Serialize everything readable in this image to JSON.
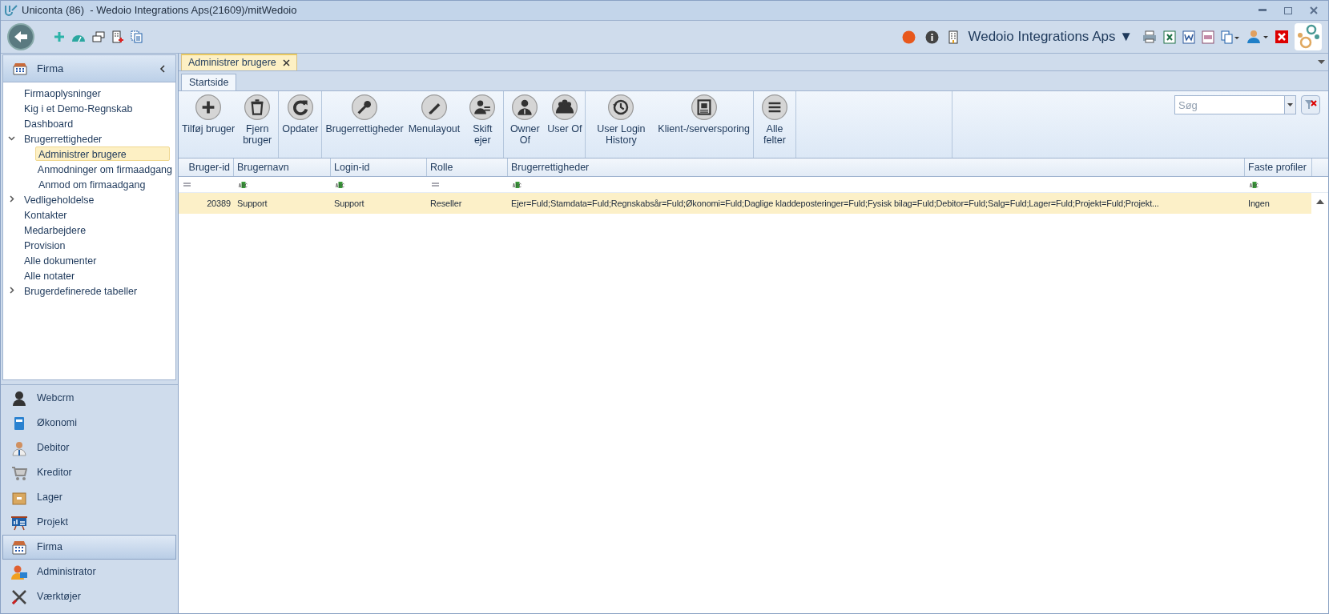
{
  "window": {
    "title": "Uniconta (86)  - Wedoio Integrations Aps(21609)/mitWedoio"
  },
  "company_selector": {
    "label": "Wedoio Integrations Aps ▼"
  },
  "sidebar": {
    "header": "Firma",
    "tree": [
      {
        "label": "Firmaoplysninger",
        "selected": false
      },
      {
        "label": "Kig i et Demo-Regnskab",
        "selected": false
      },
      {
        "label": "Dashboard",
        "selected": false
      },
      {
        "label": "Brugerrettigheder",
        "selected": false,
        "expanded": true,
        "children": [
          {
            "label": "Administrer brugere",
            "selected": true
          },
          {
            "label": "Anmodninger om firmaadgang",
            "selected": false
          },
          {
            "label": "Anmod om firmaadgang",
            "selected": false
          }
        ]
      },
      {
        "label": "Vedligeholdelse",
        "selected": false,
        "expanded": false
      },
      {
        "label": "Kontakter",
        "selected": false
      },
      {
        "label": "Medarbejdere",
        "selected": false
      },
      {
        "label": "Provision",
        "selected": false
      },
      {
        "label": "Alle dokumenter",
        "selected": false
      },
      {
        "label": "Alle notater",
        "selected": false
      },
      {
        "label": "Brugerdefinerede tabeller",
        "selected": false,
        "expanded": false
      }
    ],
    "modules": [
      {
        "label": "Webcrm",
        "kind": "person",
        "selected": false
      },
      {
        "label": "Økonomi",
        "kind": "book",
        "selected": false
      },
      {
        "label": "Debitor",
        "kind": "customer",
        "selected": false
      },
      {
        "label": "Kreditor",
        "kind": "cart",
        "selected": false
      },
      {
        "label": "Lager",
        "kind": "box",
        "selected": false
      },
      {
        "label": "Projekt",
        "kind": "board",
        "selected": false
      },
      {
        "label": "Firma",
        "kind": "building",
        "selected": true
      },
      {
        "label": "Administrator",
        "kind": "admin",
        "selected": false
      },
      {
        "label": "Værktøjer",
        "kind": "tools",
        "selected": false
      }
    ]
  },
  "document_tabs": [
    {
      "label": "Administrer brugere",
      "selected": true
    }
  ],
  "ribbon": {
    "tabs": [
      {
        "label": "Startside",
        "selected": true
      }
    ],
    "groups": [
      [
        {
          "label": "Tilføj bruger"
        },
        {
          "label": "Fjern bruger"
        }
      ],
      [
        {
          "label": "Opdater"
        }
      ],
      [
        {
          "label": "Brugerrettigheder"
        },
        {
          "label": "Menulayout"
        },
        {
          "label": "Skift ejer"
        }
      ],
      [
        {
          "label": "Owner Of"
        },
        {
          "label": "User Of"
        }
      ],
      [
        {
          "label": "User Login History"
        },
        {
          "label": "Klient-/serversporing"
        }
      ],
      [
        {
          "label": "Alle felter"
        }
      ]
    ],
    "search": {
      "placeholder": "Søg"
    }
  },
  "table": {
    "columns": [
      {
        "label": "Bruger-id",
        "kind": "number"
      },
      {
        "label": "Brugernavn",
        "kind": "text"
      },
      {
        "label": "Login-id",
        "kind": "text"
      },
      {
        "label": "Rolle",
        "kind": "choice"
      },
      {
        "label": "Brugerrettigheder",
        "kind": "text"
      },
      {
        "label": "Faste profiler",
        "kind": "text"
      }
    ],
    "rows": [
      {
        "selected": true,
        "cells": [
          "20389",
          "Support",
          "Support",
          "Reseller",
          "Ejer=Fuld;Stamdata=Fuld;Regnskabsår=Fuld;Økonomi=Fuld;Daglige kladdeposteringer=Fuld;Fysisk bilag=Fuld;Debitor=Fuld;Salg=Fuld;Lager=Fuld;Projekt=Fuld;Projekt...",
          "Ingen"
        ]
      }
    ]
  }
}
